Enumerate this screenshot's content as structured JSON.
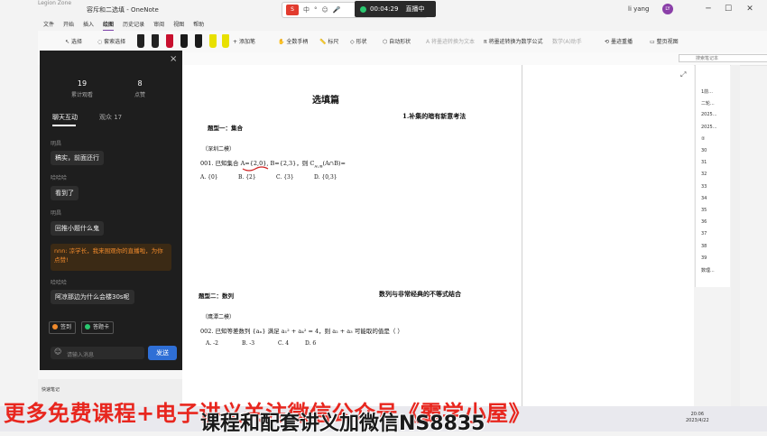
{
  "titlebar": {
    "legion": "Legion Zone",
    "title": "容斥和二选填 - OneNote",
    "user": "li yang",
    "avatar": "LY",
    "minimize": "─",
    "maximize": "☐",
    "close": "✕"
  },
  "recorder": {
    "logo": "S",
    "icons": [
      "中",
      "°",
      "☺",
      "🎤",
      "▦",
      "👕",
      "✿"
    ],
    "timer": "00:04:29",
    "state": "直播中"
  },
  "menu": [
    "文件",
    "开始",
    "插入",
    "绘图",
    "历史记录",
    "审阅",
    "视图",
    "帮助"
  ],
  "menu_active": "绘图",
  "ribbon": {
    "select": "选择",
    "lasso": "套索选择",
    "add_pen": "添加笔",
    "full_ink": "全数手柄",
    "ruler": "标尺",
    "shapes": "形状",
    "auto_shape": "自动形状",
    "ink_to_text": "将墨迹转换为文本",
    "ink_to_math": "将墨迹转换为数学公式",
    "math": "数学(A)助手",
    "replay": "墨迹重播",
    "full_page": "整页视图"
  },
  "pen_colors": [
    "#222222",
    "#222222",
    "#c8102e",
    "#1a1a1a",
    "#1a1a1a",
    "#e8e000",
    "#e8e000",
    "#333333"
  ],
  "search_placeholder": "搜索笔记本",
  "chat": {
    "views": "19",
    "views_label": "累计观看",
    "likes": "8",
    "likes_label": "点赞",
    "tab_chat": "聊天互动",
    "tab_audience": "观众 17",
    "messages": [
      {
        "name": "明昌",
        "text": "稿实，前面还行"
      },
      {
        "name": "哈哈哈",
        "text": "看到了"
      },
      {
        "name": "明昌",
        "text": "回推小题什么鬼"
      }
    ],
    "system_msg": "nnn: 凉学长，我来围观你的直播啦，为你点赞!",
    "last_name": "哈哈哈",
    "last_text": "阿凉那边为什么会楼30s呢",
    "checkin": "签到",
    "answer_card": "答题卡",
    "input_placeholder": "请输入消息",
    "send": "发送",
    "close": "×"
  },
  "page": {
    "heading": "选填篇",
    "section1": "1.补集的暗有新意考法",
    "topic1": "题型一：集合",
    "source1": "（深圳二模）",
    "q1": "001. 已知集合 A={2,0}, B={2,3}，则 C",
    "q1_sub": "A∪B",
    "q1_tail": "(A∩B)=",
    "q1_options": [
      "A. {0}",
      "B. {2}",
      "C. {3}",
      "D. {0,3}"
    ],
    "topic2": "题型二：数列",
    "section2": "数列与非常经典的不等式结合",
    "source2": "（鹰潭二模）",
    "q2": "002. 已知等差数列 {aₙ} 满足 a₁² + a₄² = 4，则 a₂ + a₃ 可能取的值是（     ）",
    "q2_options": [
      "A. -2",
      "B. -3",
      "C. 4",
      "D. 6"
    ]
  },
  "pagelist": [
    "1前...",
    "二轮...",
    "2025...",
    "2025...",
    "②",
    "30",
    "31",
    "32",
    "33",
    "34",
    "35",
    "36",
    "37",
    "38",
    "39",
    "数理..."
  ],
  "quick_notes": "快速笔记",
  "clock": {
    "time": "20:06",
    "date": "2023/4/22"
  },
  "promo": "更多免费课程+电子讲义关注微信公众号《霸学小屋》",
  "subtitle": "课程和配套讲义加微信NS8835"
}
